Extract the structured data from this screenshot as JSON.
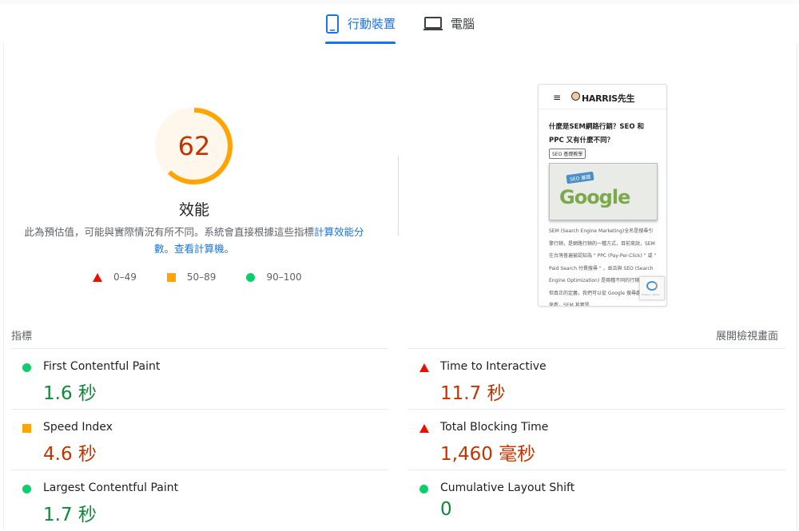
{
  "tabs": [
    {
      "label": "行動裝置",
      "icon": "smartphone-icon",
      "active": true
    },
    {
      "label": "電腦",
      "icon": "desktop-icon",
      "active": false
    }
  ],
  "score": {
    "value": "62",
    "fraction": 0.62,
    "title": "效能",
    "color": "#ffa400"
  },
  "description": {
    "text": "此為預估值，可能與實際情況有所不同。系統會直接根據這些指標",
    "link1": "計算效能分數",
    "middle": "。",
    "link2": "查看計算機",
    "end": "。"
  },
  "legend": [
    {
      "range": "0–49",
      "shape": "triangle-icon",
      "color": "#eb0f00"
    },
    {
      "range": "50–89",
      "shape": "square-icon",
      "color": "#ffa400"
    },
    {
      "range": "90–100",
      "shape": "circle-icon",
      "color": "#0cce6b"
    }
  ],
  "preview": {
    "menu": "≡",
    "logo": "HARRIS先生",
    "title": "什麼是SEM網路行銷？SEO 和 PPC 又有什麼不同？",
    "tag": "SEO 基礎教學",
    "image_badge": "SEO 基礎",
    "image_word": "Google",
    "body": "SEM (Search Engine Marketing)全名是搜尋引擎行銷，是網路行銷的一種方式，目前來說，SEM 在台灣普遍被認知為 \" PPC (Pay-Per-Click) \" 或 \" Paid Search 付費搜尋 \" ，並且與 SEO (Search Engine Optimization) 是兩種不同的行銷模式，但真正的定義，我們可以從 Google 搜尋趨勢資料來看，SEM 其實是",
    "recaptcha": "Privacy - Terms"
  },
  "metrics_header": {
    "label": "指標",
    "expand": "展開檢視畫面"
  },
  "metrics": [
    {
      "name": "First Contentful Paint",
      "value": "1.6 秒",
      "status": "good"
    },
    {
      "name": "Time to Interactive",
      "value": "11.7 秒",
      "status": "poor"
    },
    {
      "name": "Speed Index",
      "value": "4.6 秒",
      "status": "average"
    },
    {
      "name": "Total Blocking Time",
      "value": "1,460 毫秒",
      "status": "poor"
    },
    {
      "name": "Largest Contentful Paint",
      "value": "1.7 秒",
      "status": "good"
    },
    {
      "name": "Cumulative Layout Shift",
      "value": "0",
      "status": "good"
    }
  ],
  "colors": {
    "accent": "#1a73e8",
    "good": "#0cce6b",
    "average": "#ffa400",
    "poor": "#eb0f00",
    "good_text": "#0d8a38",
    "poor_text": "#c33300"
  }
}
